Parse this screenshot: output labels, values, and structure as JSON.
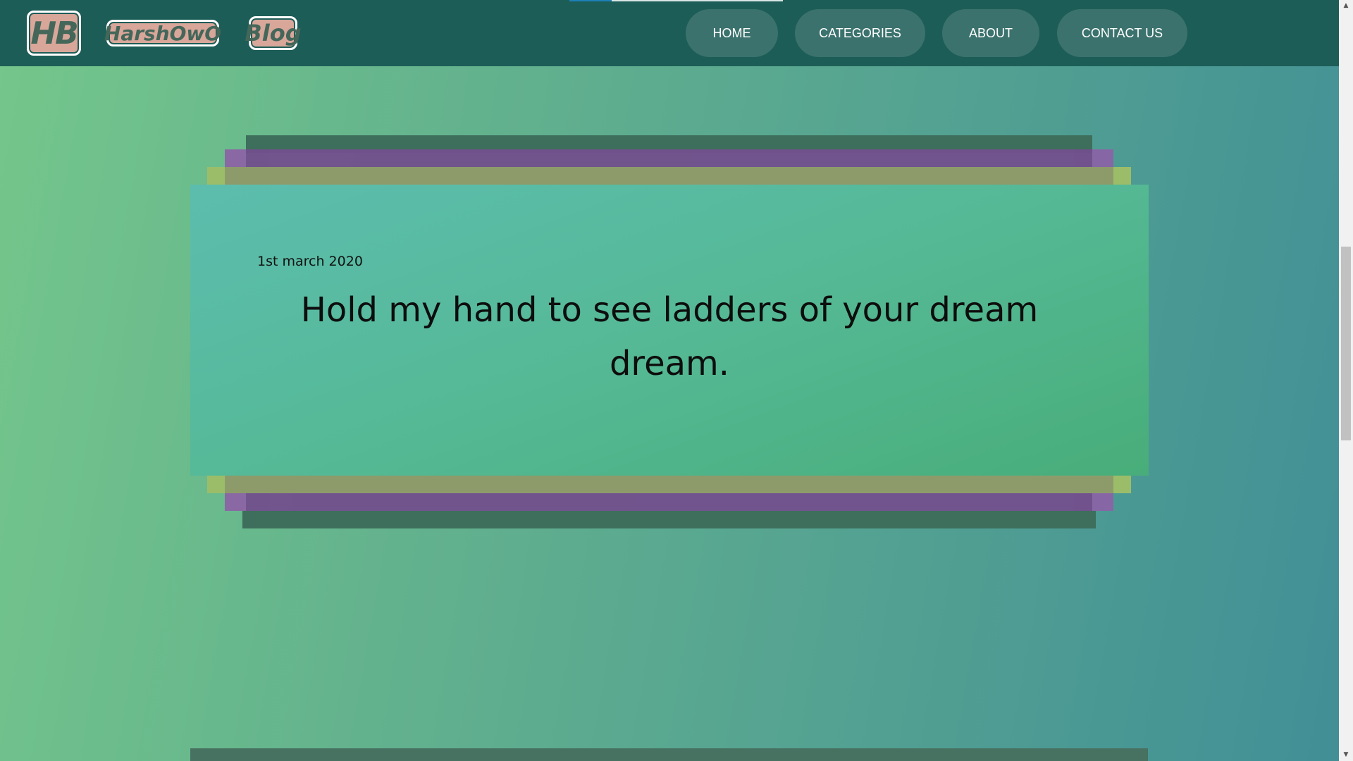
{
  "nav": {
    "brand_logo": "HB",
    "brand_name": "HarshOwO",
    "brand_blog": "Blog",
    "items": [
      {
        "label": "HOME"
      },
      {
        "label": "CATEGORIES"
      },
      {
        "label": "ABOUT"
      },
      {
        "label": "CONTACT US"
      }
    ]
  },
  "post": {
    "date": "1st march 2020",
    "title": "Hold my hand to see ladders of your dream dream."
  },
  "colors": {
    "navbar": "#1d5d57",
    "nav_button": "#3b726d",
    "brand_bg": "#d8a79a",
    "layer_dark": "#3e6e5c",
    "layer_purple": "#734f8d",
    "layer_olive": "#8d9b6b"
  },
  "scrollbar": {
    "up_icon": "chevron-up-icon",
    "down_icon": "chevron-down-icon"
  }
}
